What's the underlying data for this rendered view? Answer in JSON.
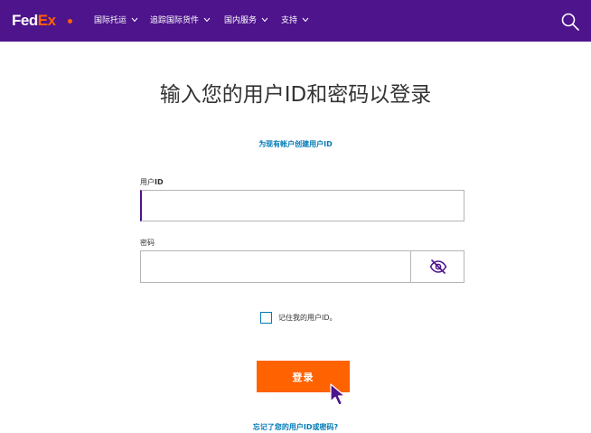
{
  "header": {
    "logo_fed": "Fed",
    "logo_ex": "Ex",
    "menu": [
      {
        "label": "国际托运"
      },
      {
        "label": "追踪国际货件"
      },
      {
        "label": "国内服务"
      },
      {
        "label": "支持"
      }
    ],
    "search_icon": "search-icon"
  },
  "login": {
    "title": "输入您的用户ID和密码以登录",
    "create_link": "为现有帐户创建用户ID",
    "userid_label_prefix": "用户",
    "userid_label_suffix": "ID",
    "userid_value": "",
    "password_label": "密码",
    "password_value": "",
    "eye_icon": "eye-slash-icon",
    "remember_label": "记住我的用户ID。",
    "remember_checked": false,
    "login_button": "登录",
    "forgot_link": "忘记了您的用户ID或密码?"
  },
  "colors": {
    "brand_purple": "#4d148c",
    "brand_orange": "#ff6200",
    "link_blue": "#007ab7"
  }
}
